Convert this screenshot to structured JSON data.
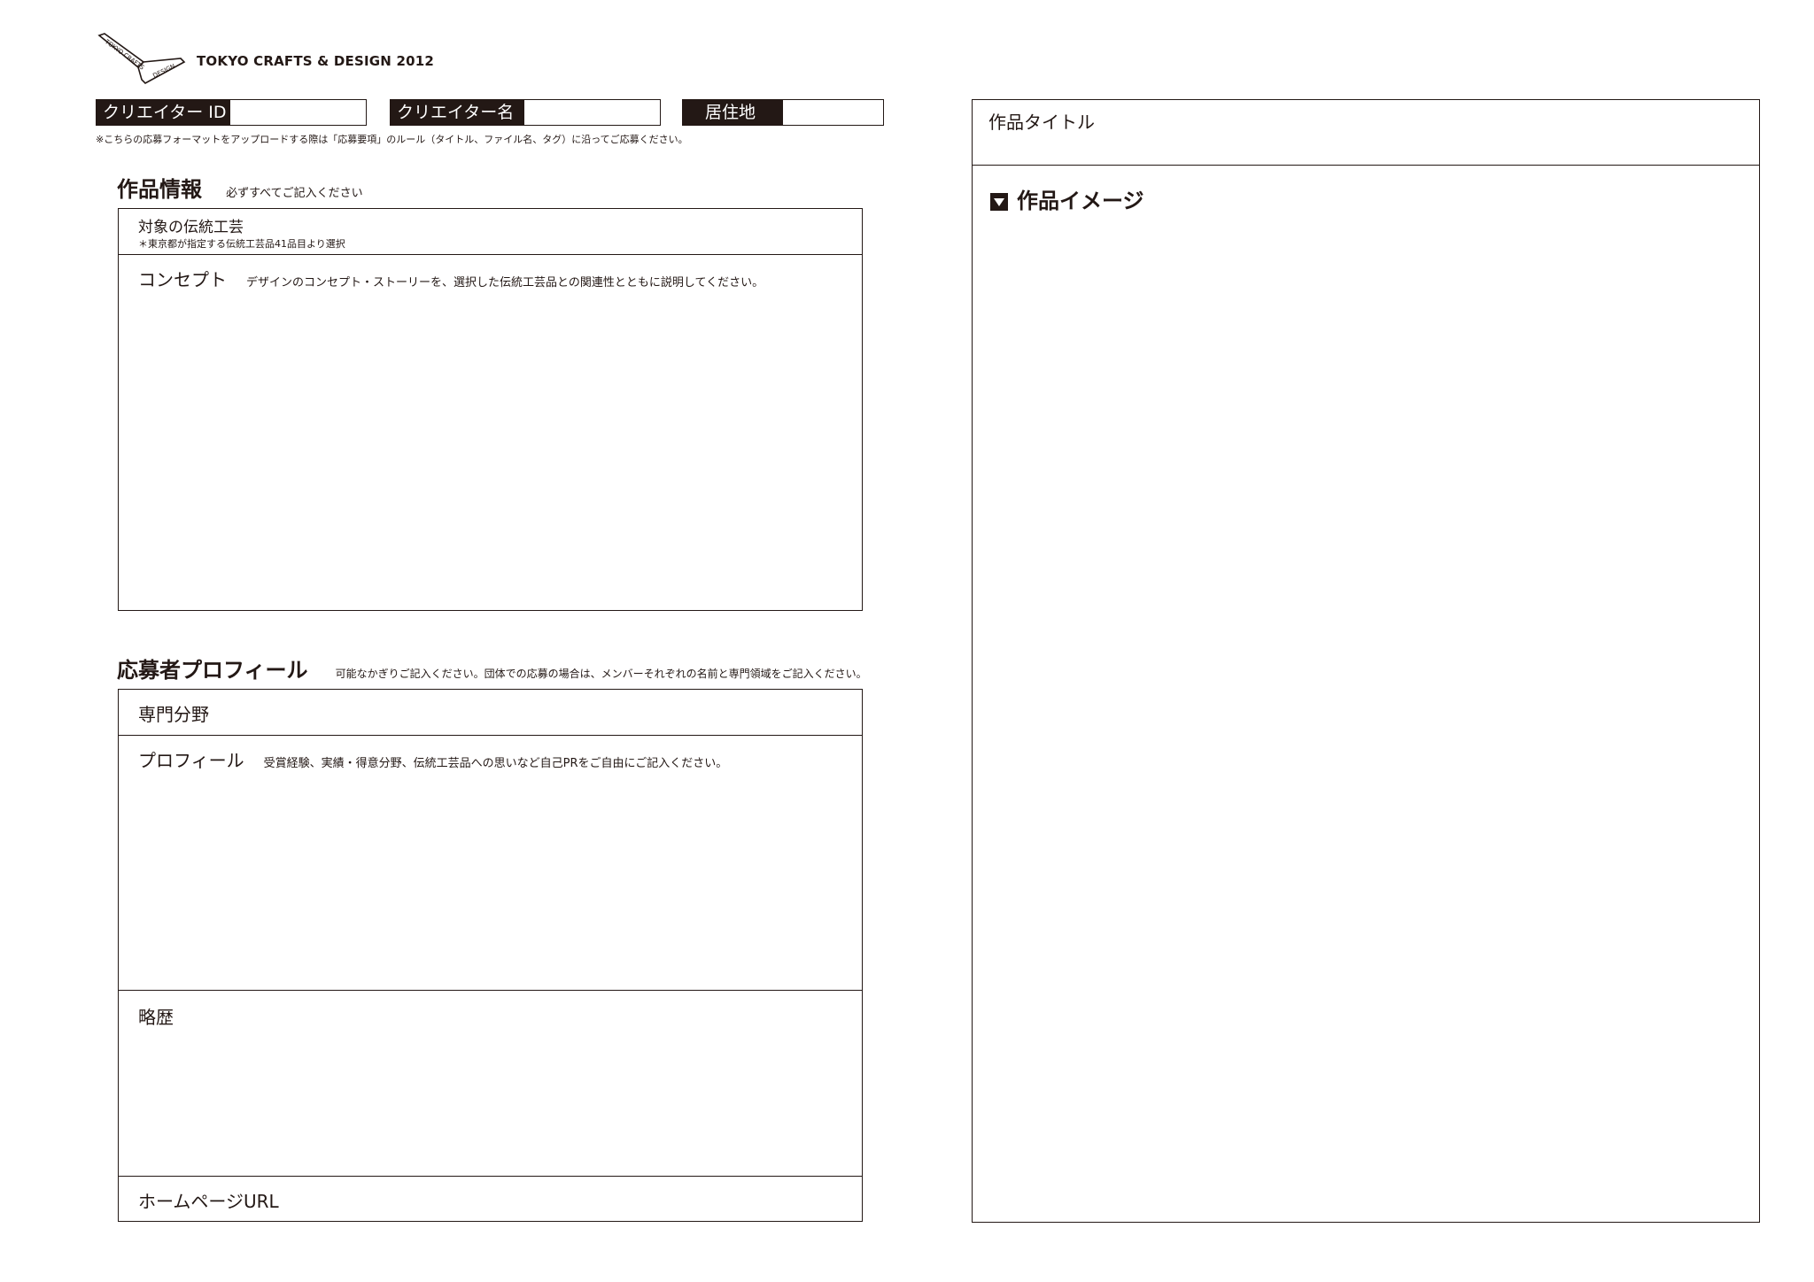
{
  "header": {
    "logo_text": "TOKYO CRAFTS & DESIGN 2012",
    "logo_mark_top": "TOKYO CRAFTS",
    "logo_mark_bottom": "DESIGN",
    "fields": [
      {
        "label": "クリエイター ID"
      },
      {
        "label": "クリエイター名"
      },
      {
        "label": "居住地"
      }
    ],
    "note": "※こちらの応募フォーマットをアップロードする際は「応募要項」のルール（タイトル、ファイル名、タグ）に沿ってご応募ください。"
  },
  "work_info": {
    "title": "作品情報",
    "subtitle": "必ずすべてご記入ください",
    "craft_label": "対象の伝統工芸",
    "craft_note": "＊東京都が指定する伝統工芸品41品目より選択",
    "concept_label": "コンセプト",
    "concept_hint": "デザインのコンセプト・ストーリーを、選択した伝統工芸品との関連性とともに説明してください。"
  },
  "profile": {
    "title": "応募者プロフィール",
    "subtitle": "可能なかぎりご記入ください。団体での応募の場合は、メンバーそれぞれの名前と専門領域をご記入ください。",
    "field_label": "専門分野",
    "profile_label": "プロフィール",
    "profile_hint": "受賞経験、実績・得意分野、伝統工芸品への思いなど自己PRをご自由にご記入ください。",
    "history_label": "略歴",
    "homepage_label": "ホームページURL"
  },
  "right_panel": {
    "work_title_label": "作品タイトル",
    "work_image_label": "作品イメージ"
  }
}
